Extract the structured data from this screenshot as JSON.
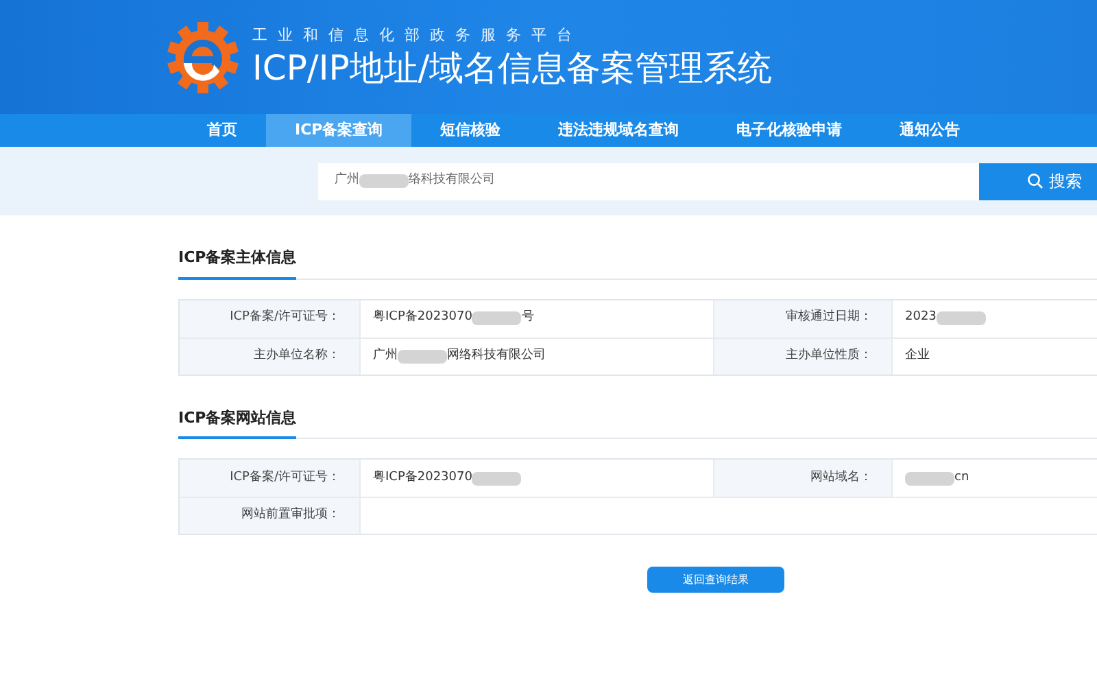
{
  "header": {
    "subtitle": "工 业 和 信 息 化 部 政 务 服 务 平 台",
    "title": "ICP/IP地址/域名信息备案管理系统"
  },
  "nav": [
    {
      "label": "首页",
      "selected": false
    },
    {
      "label": "ICP备案查询",
      "selected": true
    },
    {
      "label": "短信核验",
      "selected": false
    },
    {
      "label": "违法违规域名查询",
      "selected": false
    },
    {
      "label": "电子化核验申请",
      "selected": false
    },
    {
      "label": "通知公告",
      "selected": false
    }
  ],
  "search": {
    "value_parts": [
      {
        "kind": "text",
        "text": "广州"
      },
      {
        "kind": "redaction"
      },
      {
        "kind": "text",
        "text": "络科技有限公司"
      }
    ],
    "button": "搜索"
  },
  "sections": [
    {
      "title": "ICP备案主体信息",
      "rows": [
        [
          {
            "label": "ICP备案/许可证号：",
            "value_parts": [
              {
                "kind": "text",
                "text": "粤ICP备2023070"
              },
              {
                "kind": "redaction"
              },
              {
                "kind": "text",
                "text": "号"
              }
            ]
          },
          {
            "label": "审核通过日期：",
            "value_parts": [
              {
                "kind": "text",
                "text": "2023"
              },
              {
                "kind": "redaction"
              }
            ]
          }
        ],
        [
          {
            "label": "主办单位名称：",
            "value_parts": [
              {
                "kind": "text",
                "text": "广州"
              },
              {
                "kind": "redaction"
              },
              {
                "kind": "text",
                "text": "网络科技有限公司"
              }
            ]
          },
          {
            "label": "主办单位性质：",
            "value_parts": [
              {
                "kind": "text",
                "text": "企业"
              }
            ]
          }
        ]
      ]
    },
    {
      "title": "ICP备案网站信息",
      "rows": [
        [
          {
            "label": "ICP备案/许可证号：",
            "value_parts": [
              {
                "kind": "text",
                "text": "粤ICP备2023070"
              },
              {
                "kind": "redaction"
              }
            ]
          },
          {
            "label": "网站域名：",
            "value_parts": [
              {
                "kind": "redaction"
              },
              {
                "kind": "text",
                "text": "cn"
              }
            ]
          }
        ],
        [
          {
            "label": "网站前置审批项："
          }
        ]
      ]
    }
  ],
  "back_button": "返回查询结果"
}
